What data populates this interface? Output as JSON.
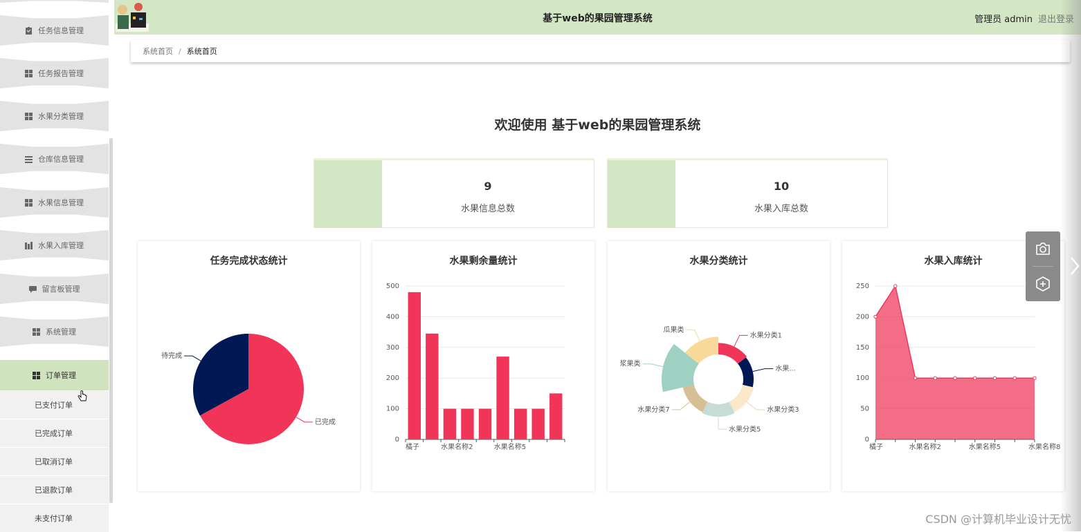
{
  "header": {
    "title": "基于web的果园管理系统",
    "role": "管理员 admin",
    "logout": "退出登录"
  },
  "sidebar": {
    "items": [
      {
        "label": "任务信息管理",
        "icon": "clipboard-icon"
      },
      {
        "label": "任务报告管理",
        "icon": "grid-icon"
      },
      {
        "label": "水果分类管理",
        "icon": "grid-icon"
      },
      {
        "label": "仓库信息管理",
        "icon": "list-icon"
      },
      {
        "label": "水果信息管理",
        "icon": "grid-icon"
      },
      {
        "label": "水果入库管理",
        "icon": "building-icon"
      },
      {
        "label": "留言板管理",
        "icon": "message-icon"
      },
      {
        "label": "系统管理",
        "icon": "grid-icon"
      },
      {
        "label": "订单管理",
        "icon": "grid-icon",
        "active": true
      }
    ],
    "subitems": [
      "已支付订单",
      "已完成订单",
      "已取消订单",
      "已退款订单",
      "未支付订单"
    ]
  },
  "breadcrumb": {
    "home": "系统首页",
    "separator": "/",
    "current": "系统首页"
  },
  "welcome": "欢迎使用 基于web的果园管理系统",
  "stats": [
    {
      "value": "9",
      "label": "水果信息总数"
    },
    {
      "value": "10",
      "label": "水果入库总数"
    }
  ],
  "colors": {
    "accent": "#d4e7c5",
    "red": "#f03558",
    "navy": "#001853"
  },
  "chart_data": [
    {
      "type": "pie",
      "title": "任务完成状态统计",
      "slices": [
        {
          "name": "已完成",
          "value": 67,
          "color": "#f03558"
        },
        {
          "name": "待完成",
          "value": 33,
          "color": "#001853"
        }
      ]
    },
    {
      "type": "bar",
      "title": "水果剩余量统计",
      "categories": [
        "橘子",
        "",
        "水果名称2",
        "",
        "",
        "水果名称5",
        "",
        "",
        ""
      ],
      "values": [
        480,
        345,
        100,
        100,
        100,
        270,
        100,
        100,
        150
      ],
      "yticks": [
        0,
        100,
        200,
        300,
        400,
        500
      ],
      "ylim": [
        0,
        500
      ],
      "color": "#f03558"
    },
    {
      "type": "pie",
      "title": "水果分类统计",
      "variant": "nightingale-rose",
      "slices": [
        {
          "name": "水果分类1",
          "value": 22,
          "color": "#f03558"
        },
        {
          "name": "水果...",
          "value": 20,
          "color": "#001853"
        },
        {
          "name": "水果分类3",
          "value": 22,
          "color": "#fbe8c8"
        },
        {
          "name": "水果分类5",
          "value": 24,
          "color": "#c7dcd6"
        },
        {
          "name": "水果分类7",
          "value": 22,
          "color": "#d6bf95"
        },
        {
          "name": "浆果类",
          "value": 58,
          "color": "#9fd1c2"
        },
        {
          "name": "瓜果类",
          "value": 33,
          "color": "#f8d99a"
        }
      ]
    },
    {
      "type": "area",
      "title": "水果入库统计",
      "categories": [
        "橘子",
        "",
        "水果名称2",
        "",
        "",
        "水果名称5",
        "",
        "",
        "水果名称8"
      ],
      "values": [
        200,
        250,
        100,
        100,
        100,
        100,
        100,
        100,
        100
      ],
      "yticks": [
        0,
        50,
        100,
        150,
        200,
        250
      ],
      "ylim": [
        0,
        250
      ],
      "color": "#f03558"
    }
  ],
  "watermark": "CSDN @计算机毕业设计无忧"
}
